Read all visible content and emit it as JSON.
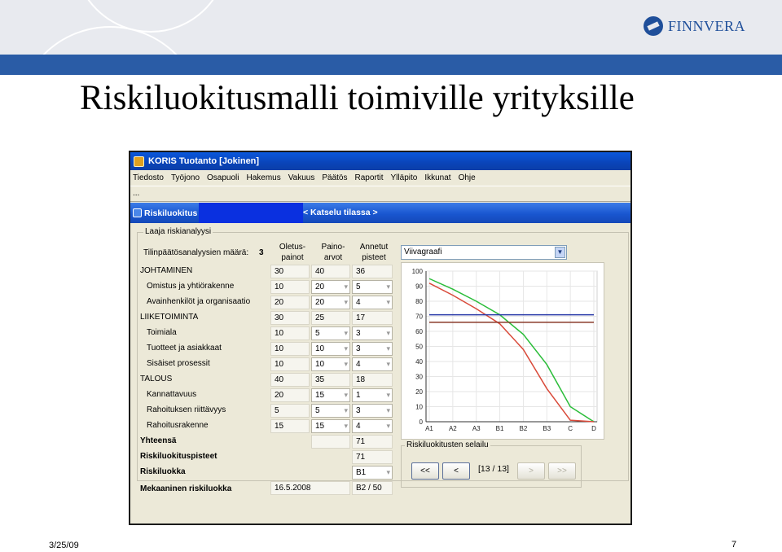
{
  "slide": {
    "title": "Riskiluokitusmalli toimiville yrityksille",
    "logo_text": "FINNVERA",
    "date": "3/25/09",
    "page_number": "7"
  },
  "app": {
    "window_title": "KORIS Tuotanto [Jokinen]",
    "menu": [
      "Tiedosto",
      "Työjono",
      "Osapuoli",
      "Hakemus",
      "Vakuus",
      "Päätös",
      "Raportit",
      "Ylläpito",
      "Ikkunat",
      "Ohje"
    ],
    "toolbar_glyph": "...",
    "subwindow_title": "Riskiluokitus",
    "mode_label": "< Katselu tilassa >",
    "section_label": "Laaja riskianalyysi",
    "count_label": "Tilinpäätösanalyysien määrä:",
    "count_value": "3",
    "columns": {
      "default_weights": [
        "Oletus-",
        "painot"
      ],
      "weight_values": [
        "Paino-",
        "arvot"
      ],
      "given_points": [
        "Annetut",
        "pisteet"
      ]
    },
    "rows": [
      {
        "label": "JOHTAMINEN",
        "default": "30",
        "weight": "40",
        "points": "36",
        "level": 0
      },
      {
        "label": "Omistus ja yhtiörakenne",
        "default": "10",
        "weight": "20",
        "points": "5",
        "level": 1
      },
      {
        "label": "Avainhenkilöt ja organisaatio",
        "default": "20",
        "weight": "20",
        "points": "4",
        "level": 1
      },
      {
        "label": "LIIKETOIMINTA",
        "default": "30",
        "weight": "25",
        "points": "17",
        "level": 0
      },
      {
        "label": "Toimiala",
        "default": "10",
        "weight": "5",
        "points": "3",
        "level": 1
      },
      {
        "label": "Tuotteet ja asiakkaat",
        "default": "10",
        "weight": "10",
        "points": "3",
        "level": 1
      },
      {
        "label": "Sisäiset prosessit",
        "default": "10",
        "weight": "10",
        "points": "4",
        "level": 1
      },
      {
        "label": "TALOUS",
        "default": "40",
        "weight": "35",
        "points": "18",
        "level": 0
      },
      {
        "label": "Kannattavuus",
        "default": "20",
        "weight": "15",
        "points": "1",
        "level": 1
      },
      {
        "label": "Rahoituksen riittävyys",
        "default": "5",
        "weight": "5",
        "points": "3",
        "level": 1
      },
      {
        "label": "Rahoitusrakenne",
        "default": "15",
        "weight": "15",
        "points": "4",
        "level": 1
      }
    ],
    "summary": {
      "total_label": "Yhteensä",
      "total_value": "71",
      "score_label": "Riskiluokituspisteet",
      "score_value": "71",
      "class_label": "Riskiluokka",
      "class_value": "B1",
      "mech_label": "Mekaaninen riskiluokka",
      "mech_date": "16.5.2008",
      "mech_value": "B2 / 50"
    },
    "chart_select_value": "Viivagraafi",
    "browser": {
      "label": "Riskiluokitusten selailu",
      "first": "<<",
      "prev": "<",
      "position": "[13 / 13]",
      "next": ">",
      "last": ">>"
    }
  },
  "chart_data": {
    "type": "line",
    "categories": [
      "A1",
      "A2",
      "A3",
      "B1",
      "B2",
      "B3",
      "C",
      "D"
    ],
    "ylim": [
      0,
      100
    ],
    "yticks": [
      0,
      10,
      20,
      30,
      40,
      50,
      60,
      70,
      80,
      90,
      100
    ],
    "series": [
      {
        "color": "#2bbd3a",
        "values": [
          95,
          88,
          80,
          71,
          58,
          38,
          10,
          0
        ]
      },
      {
        "color": "#d94a3a",
        "values": [
          92,
          84,
          75,
          65,
          48,
          22,
          1,
          0
        ]
      },
      {
        "color": "#2a3aa8",
        "values": [
          71,
          71,
          71,
          71,
          71,
          71,
          71,
          71
        ]
      },
      {
        "color": "#8a3a2a",
        "values": [
          66,
          66,
          66,
          66,
          66,
          66,
          66,
          66
        ]
      }
    ]
  }
}
